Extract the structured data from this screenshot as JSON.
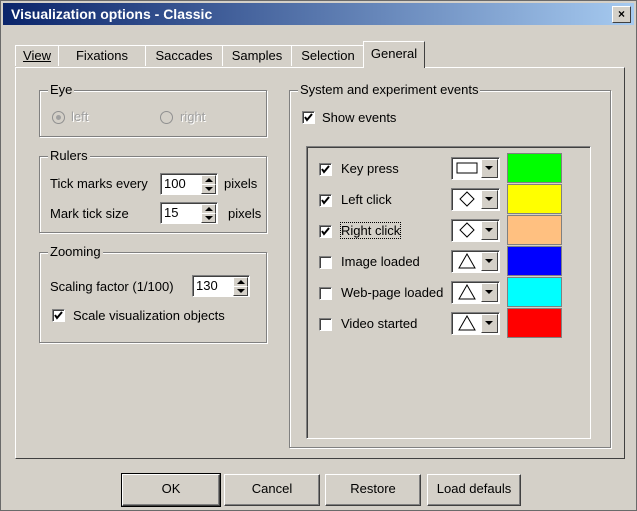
{
  "window": {
    "title": "Visualization options - Classic",
    "close_glyph": "×"
  },
  "tabs": [
    {
      "label": "View",
      "mnemonic_index": 0
    },
    {
      "label": "Fixations",
      "mnemonic_index": 0
    },
    {
      "label": "Saccades",
      "mnemonic_index": 0
    },
    {
      "label": "Samples",
      "mnemonic_index": 2
    },
    {
      "label": "Selection",
      "mnemonic_index": 3
    },
    {
      "label": "General",
      "mnemonic_index": 0,
      "active": true
    }
  ],
  "eye": {
    "legend": "Eye",
    "left_label": "left",
    "right_label": "right",
    "selected": "left"
  },
  "rulers": {
    "legend": "Rulers",
    "tick_label": "Tick marks every",
    "tick_value": "100",
    "tick_unit": "pixels",
    "mark_label": "Mark tick size",
    "mark_value": "15",
    "mark_unit": "pixels"
  },
  "zooming": {
    "legend": "Zooming",
    "scaling_label": "Scaling factor (1/100)",
    "scaling_value": "130",
    "scale_objects_label": "Scale visualization objects",
    "scale_objects_checked": true
  },
  "events": {
    "legend": "System and experiment events",
    "show_events_label": "Show events",
    "show_events_checked": true,
    "items": [
      {
        "label": "Key press",
        "checked": true,
        "shape": "rectangle",
        "color": "#00ff00"
      },
      {
        "label": "Left click",
        "checked": true,
        "shape": "diamond",
        "color": "#ffff00"
      },
      {
        "label": "Right click",
        "checked": true,
        "shape": "diamond",
        "color": "#ffc080"
      },
      {
        "label": "Image loaded",
        "checked": false,
        "shape": "triangle",
        "color": "#0000ff"
      },
      {
        "label": "Web-page loaded",
        "checked": false,
        "shape": "triangle",
        "color": "#00ffff"
      },
      {
        "label": "Video started",
        "checked": false,
        "shape": "triangle",
        "color": "#ff0000"
      }
    ]
  },
  "buttons": {
    "ok": "OK",
    "cancel": "Cancel",
    "restore": "Restore",
    "load_defaults": "Load defauls"
  }
}
